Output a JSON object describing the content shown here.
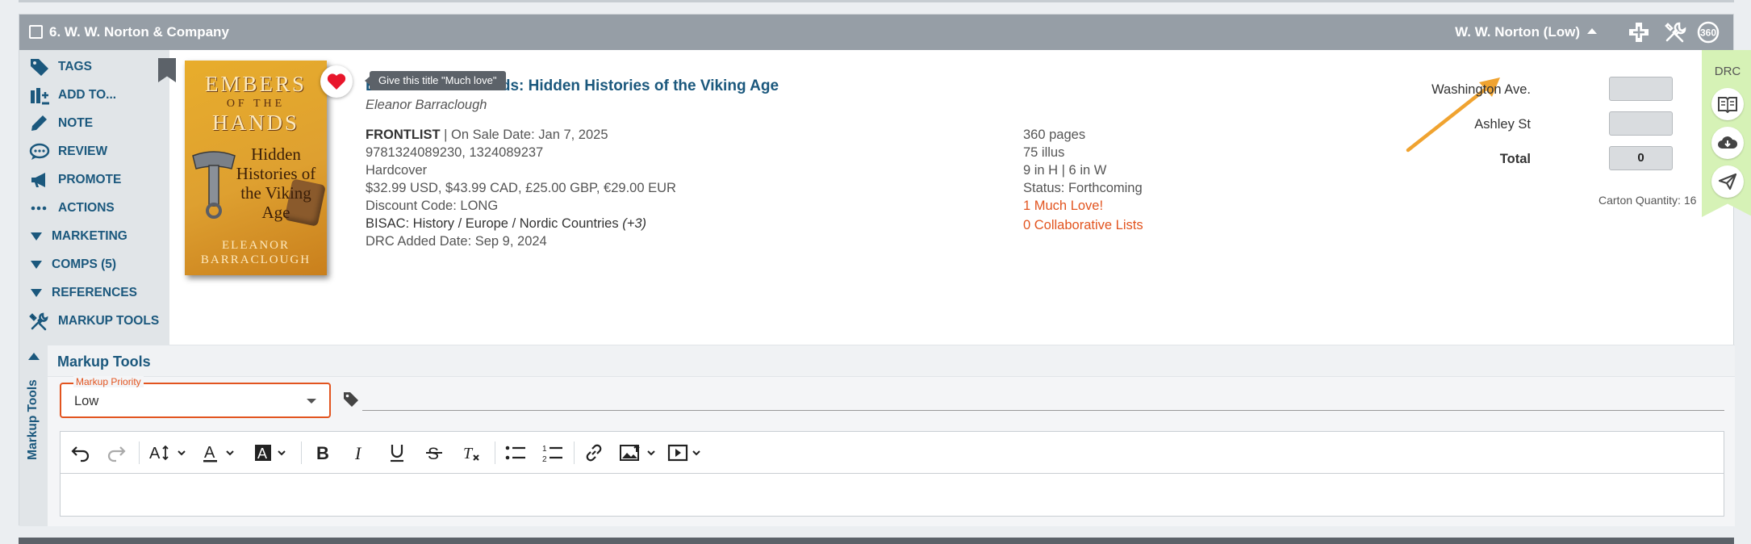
{
  "card": {
    "title": "6. W. W. Norton & Company",
    "publisher_filter": "W. W. Norton (Low)"
  },
  "sidebar": [
    {
      "label": "TAGS",
      "icon": "tag-icon"
    },
    {
      "label": "ADD TO...",
      "icon": "add-to-icon"
    },
    {
      "label": "NOTE",
      "icon": "pencil-icon"
    },
    {
      "label": "REVIEW",
      "icon": "chat-icon"
    },
    {
      "label": "PROMOTE",
      "icon": "megaphone-icon"
    },
    {
      "label": "ACTIONS",
      "icon": "dots-icon"
    },
    {
      "label": "MARKETING",
      "icon": "triangle-down-icon"
    },
    {
      "label": "COMPS (5)",
      "icon": "triangle-down-icon"
    },
    {
      "label": "REFERENCES",
      "icon": "triangle-down-icon"
    },
    {
      "label": "MARKUP TOOLS",
      "icon": "tools-icon"
    }
  ],
  "cover": {
    "line1": "EMBERS",
    "line2": "OF THE",
    "line3": "HANDS",
    "subtitle": "Hidden Histories of the Viking Age",
    "author": "ELEANOR BARRACLOUGH"
  },
  "tooltip": "Give this title \"Much love\"",
  "book": {
    "title": "Embers of the Hands: Hidden Histories of the Viking Age",
    "author": "Eleanor Barraclough",
    "status_label": "FRONTLIST",
    "on_sale": "| On Sale Date: Jan 7, 2025",
    "isbns": "9781324089230, 1324089237",
    "format": "Hardcover",
    "prices": "$32.99 USD, $43.99 CAD, £25.00 GBP, €29.00 EUR",
    "discount": "Discount Code: LONG",
    "bisac": "BISAC: History / Europe / Nordic Countries",
    "bisac_more": "(+3)",
    "drc_added": "DRC Added Date: Sep 9, 2024",
    "pages": "360 pages",
    "illus": "75 illus",
    "dimensions": "9 in H | 6 in W",
    "pub_status": "Status: Forthcoming",
    "much_love": "1 Much Love!",
    "collab_lists": "0 Collaborative Lists"
  },
  "order": {
    "locations": [
      {
        "name": "Washington Ave.",
        "qty": ""
      },
      {
        "name": "Ashley St",
        "qty": ""
      }
    ],
    "total_label": "Total",
    "total_value": "0",
    "carton": "Carton Quantity: 16"
  },
  "drc": {
    "label": "DRC"
  },
  "markup": {
    "section_title": "Markup Tools",
    "vertical_label": "Markup Tools",
    "priority_label": "Markup Priority",
    "priority_value": "Low"
  },
  "colors": {
    "accent": "#1b587d",
    "orange": "#e2541f",
    "header": "#969ea6",
    "drc_green": "#d6f2b6",
    "arrow": "#f0a330"
  }
}
